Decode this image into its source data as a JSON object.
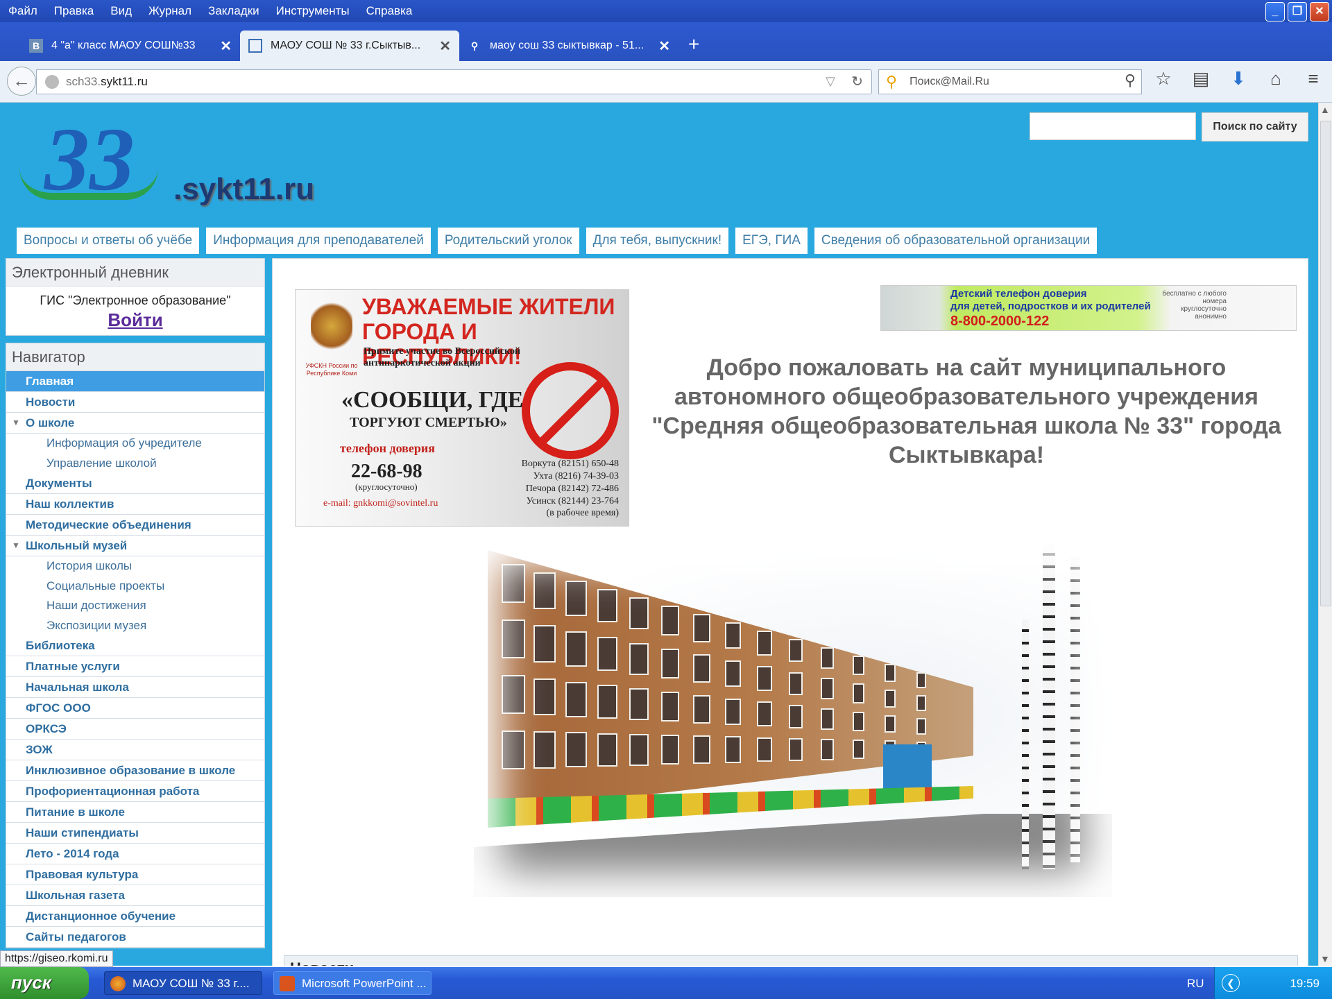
{
  "menubar": {
    "items": [
      "Файл",
      "Правка",
      "Вид",
      "Журнал",
      "Закладки",
      "Инструменты",
      "Справка"
    ]
  },
  "tabs": [
    {
      "icon": "В",
      "label": "4 \"а\" класс МАОУ СОШ№33",
      "active": false
    },
    {
      "icon": "▭",
      "label": "МАОУ СОШ № 33 г.Сыктыв...",
      "active": true
    },
    {
      "icon": "🔍",
      "label": "маоу сош 33 сыктывкар - 51...",
      "active": false
    }
  ],
  "navbar": {
    "url_prefix": "sch33.",
    "url_domain": "sykt11.ru",
    "search_placeholder": "Поиск@Mail.Ru",
    "icons": [
      "star-icon",
      "bookmarks-list-icon",
      "download-icon",
      "home-icon",
      "menu-icon"
    ]
  },
  "site": {
    "logo_number": "33",
    "logo_domain": ".sykt11.ru",
    "search_button": "Поиск по сайту",
    "top_nav": [
      "Вопросы и ответы об учёбе",
      "Информация для преподавателей",
      "Родительский уголок",
      "Для тебя, выпускник!",
      "ЕГЭ, ГИА",
      "Сведения об образовательной организации"
    ]
  },
  "diary": {
    "title": "Электронный дневник",
    "gis": "ГИС \"Электронное образование\"",
    "login": "Войти"
  },
  "navigator": {
    "title": "Навигатор",
    "items": [
      {
        "label": "Главная",
        "type": "item",
        "active": true
      },
      {
        "label": "Новости",
        "type": "item"
      },
      {
        "label": "О школе",
        "type": "group"
      },
      {
        "label": "Информация об учредителе",
        "type": "sub"
      },
      {
        "label": "Управление школой",
        "type": "sub"
      },
      {
        "label": "Документы",
        "type": "item"
      },
      {
        "label": "Наш коллектив",
        "type": "item"
      },
      {
        "label": "Методические объединения",
        "type": "item"
      },
      {
        "label": "Школьный музей",
        "type": "group"
      },
      {
        "label": "История школы",
        "type": "sub"
      },
      {
        "label": "Социальные проекты",
        "type": "sub"
      },
      {
        "label": "Наши достижения",
        "type": "sub"
      },
      {
        "label": "Экспозиции музея",
        "type": "sub"
      },
      {
        "label": "Библиотека",
        "type": "item"
      },
      {
        "label": "Платные услуги",
        "type": "item"
      },
      {
        "label": "Начальная школа",
        "type": "item"
      },
      {
        "label": "ФГОС ООО",
        "type": "item"
      },
      {
        "label": "ОРКСЭ",
        "type": "item"
      },
      {
        "label": "ЗОЖ",
        "type": "item"
      },
      {
        "label": "Инклюзивное образование в школе",
        "type": "item"
      },
      {
        "label": "Профориентационная работа",
        "type": "item"
      },
      {
        "label": "Питание в школе",
        "type": "item"
      },
      {
        "label": "Наши стипендиаты",
        "type": "item"
      },
      {
        "label": "Лето - 2014 года",
        "type": "item"
      },
      {
        "label": "Правовая культура",
        "type": "item"
      },
      {
        "label": "Школьная газета",
        "type": "item"
      },
      {
        "label": "Дистанционное обучение",
        "type": "item"
      },
      {
        "label": "Сайты педагогов",
        "type": "item"
      }
    ]
  },
  "ad": {
    "title": "УВАЖАЕМЫЕ ЖИТЕЛИ ГОРОДА И РЕСПУБЛИКИ!",
    "invite": "Примите участие во Всероссийской антинаркотической акции",
    "slogan1": "«СООБЩИ, ГДЕ",
    "slogan2": "ТОРГУЮТ СМЕРТЬЮ»",
    "hotline_label": "телефон доверия",
    "hotline": "22-68-98",
    "hotline_note": "(круглосуточно)",
    "email": "e-mail: gnkkomi@sovintel.ru",
    "emblem_text": "УФСКН России по Республике Коми",
    "cities": [
      "Воркута  (82151) 650-48",
      "Ухта  (8216) 74-39-03",
      "Печора  (82142) 72-486",
      "Усинск  (82144) 23-764"
    ],
    "work_hours": "(в рабочее время)"
  },
  "banner": {
    "line1": "Детский телефон доверия",
    "line2": "для детей, подростков и их родителей",
    "phone": "8-800-2000-122",
    "note": "бесплатно с любого номера круглосуточно анонимно"
  },
  "welcome": "Добро пожаловать на сайт муниципального автономного общеобразовательного учреждения \"Средняя общеобразовательная школа № 33\" города Сыктывкара!",
  "news_title": "Новости",
  "status_url": "https://giseo.rkomi.ru",
  "taskbar": {
    "start": "пуск",
    "buttons": [
      "МАОУ СОШ № 33 г....",
      "Microsoft PowerPoint ..."
    ],
    "lang": "RU",
    "time": "19:59"
  }
}
